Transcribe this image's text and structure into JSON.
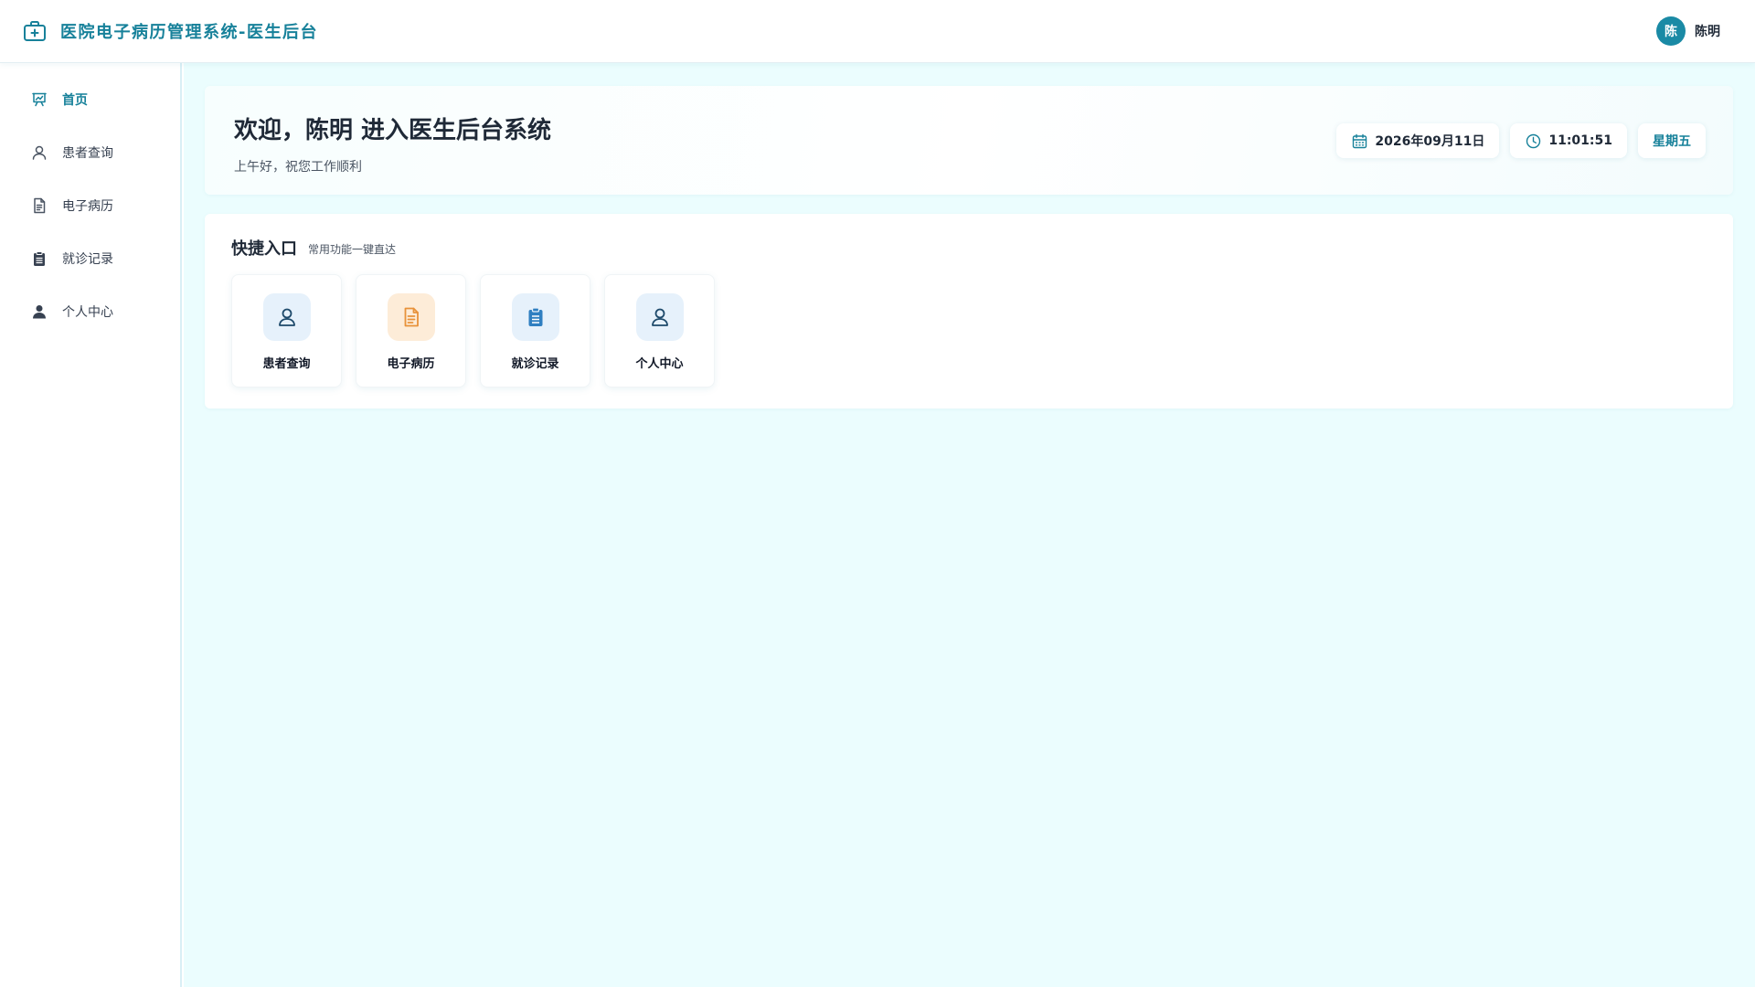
{
  "header": {
    "title": "医院电子病历管理系统-医生后台",
    "brand_icon": "medical-kit-icon",
    "user": {
      "avatar_text": "陈",
      "name": "陈明"
    }
  },
  "sidebar": {
    "items": [
      {
        "label": "首页",
        "icon": "presentation-chart-icon",
        "active": true
      },
      {
        "label": "患者查询",
        "icon": "user-icon",
        "active": false
      },
      {
        "label": "电子病历",
        "icon": "document-icon",
        "active": false
      },
      {
        "label": "就诊记录",
        "icon": "clipboard-icon",
        "active": false
      },
      {
        "label": "个人中心",
        "icon": "user-solid-icon",
        "active": false
      }
    ]
  },
  "welcome": {
    "title": "欢迎，陈明 进入医生后台系统",
    "subtitle": "上午好，祝您工作顺利",
    "date": "2026年09月11日",
    "time": "11:01:51",
    "weekday": "星期五"
  },
  "quick": {
    "title": "快捷入口",
    "subtitle": "常用功能一键直达",
    "cards": [
      {
        "label": "患者查询",
        "icon": "user-icon"
      },
      {
        "label": "电子病历",
        "icon": "document-icon"
      },
      {
        "label": "就诊记录",
        "icon": "clipboard-icon"
      },
      {
        "label": "个人中心",
        "icon": "user-icon"
      }
    ]
  },
  "colors": {
    "accent": "#17819a",
    "main_bg": "#ebfdfe",
    "card_icon_blue": "#e6f1fb",
    "card_icon_orange": "#fdecd8",
    "orange_icon": "#e8923a",
    "navy_icon": "#1e4a6b",
    "blue_icon": "#2f7fc1"
  }
}
